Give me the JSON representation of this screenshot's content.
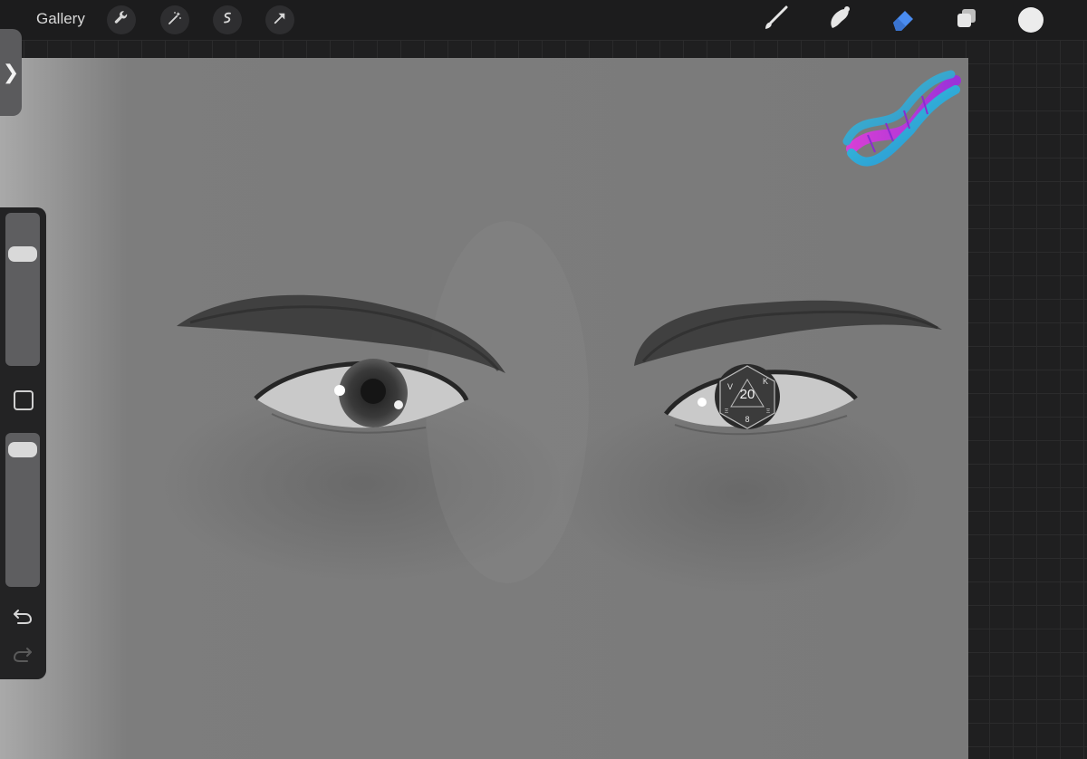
{
  "toolbar": {
    "gallery_label": "Gallery",
    "left_tools": [
      "wrench-icon",
      "magic-wand-icon",
      "selection-icon",
      "transform-arrow-icon"
    ],
    "right_tools": [
      "brush-icon",
      "smudge-icon",
      "eraser-icon",
      "layers-icon"
    ],
    "active_tool": "eraser-icon",
    "active_color": "#4a8cf0",
    "current_color": "#ececec"
  },
  "sidebar": {
    "toggle_glyph": "❯",
    "brush_size_level": 0.77,
    "opacity_level": 0.95
  },
  "canvas": {
    "d20_number": "20",
    "d20_faces": [
      "V",
      "K",
      "8",
      "Ξ",
      "Ξ"
    ]
  }
}
